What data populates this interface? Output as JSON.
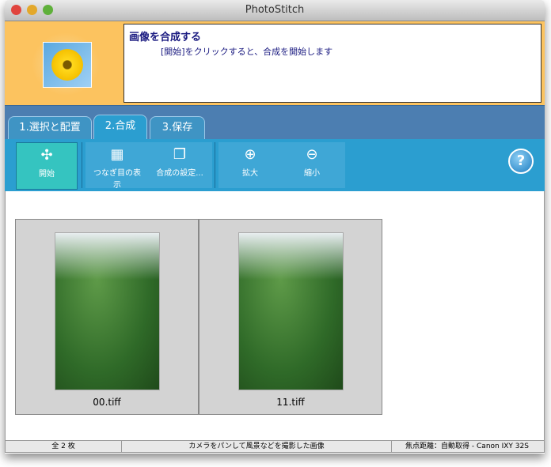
{
  "window": {
    "title": "PhotoStitch"
  },
  "header": {
    "title": "画像を合成する",
    "description": "[開始]をクリックすると、合成を開始します"
  },
  "tabs": [
    {
      "label": "1.選択と配置"
    },
    {
      "label": "2.合成",
      "active": true
    },
    {
      "label": "3.保存"
    }
  ],
  "toolbar": {
    "start": "開始",
    "show_seams": "つなぎ目の表示",
    "settings": "合成の設定...",
    "zoom_in": "拡大",
    "zoom_out": "縮小",
    "help": "?"
  },
  "images": [
    {
      "name": "00.tiff"
    },
    {
      "name": "11.tiff"
    }
  ],
  "status": {
    "count": "全 2 枚",
    "mode": "カメラをパンして風景などを撮影した画像",
    "focal": "焦点距離：自動取得 - Canon IXY 32S"
  }
}
